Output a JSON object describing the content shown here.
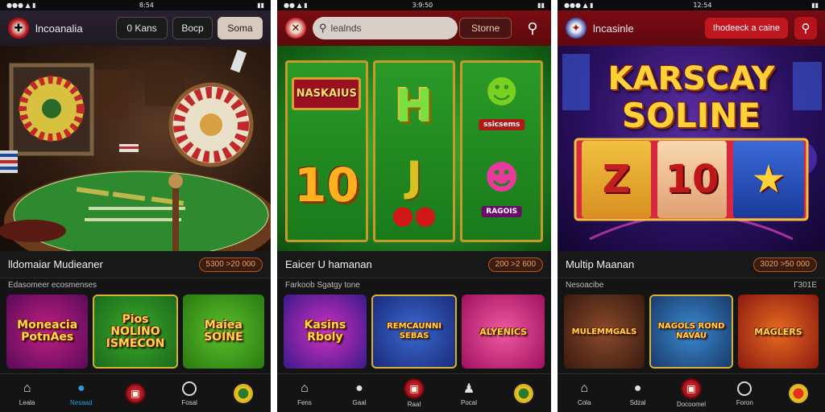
{
  "screens": [
    {
      "status": {
        "time": "8:54",
        "icons": "●●● ▲ ▮"
      },
      "header": {
        "app_name": "lncoanalia",
        "btn1": "0 Kans",
        "btn2": "Bocp",
        "btn3": "Soma"
      },
      "game_title": "lldomaiar Mudieaner",
      "badge": "5300 >20 000",
      "section_label": "Edasomeer ecosmenses",
      "thumbnails": [
        "Moneacia PotnAes",
        "Pios NOLINO ISMECON",
        "Maiea SOINE"
      ],
      "nav": [
        {
          "label": "Leala",
          "icon": "home-icon"
        },
        {
          "label": "Nesaad",
          "icon": "user-icon"
        },
        {
          "label": "",
          "icon": "wallet-icon"
        },
        {
          "label": "Fosal",
          "icon": "circle-icon"
        },
        {
          "label": "",
          "icon": "coin-icon"
        }
      ],
      "hero_labels": {
        "chips": "",
        "table_text": ""
      }
    },
    {
      "status": {
        "time": "3:9:50",
        "icons": "●● ▲ ▮"
      },
      "header": {
        "search_placeholder": "lealnds",
        "store_label": "Storne"
      },
      "hero": {
        "s1": "NASKAIUS",
        "s2": "H",
        "s3": "10",
        "s4": "J",
        "s5": "ssicsems",
        "s6": "RAGOIS"
      },
      "game_title": "Eaicer U hamanan",
      "badge": "200 >2 600",
      "section_label": "Farkoob Sgatgy tone",
      "thumbnails": [
        "Kasins Rboly",
        "REMCAUNNI SEBAS",
        "ALYENICS"
      ],
      "nav": [
        {
          "label": "Fens",
          "icon": "home-icon"
        },
        {
          "label": "Gaal",
          "icon": "user-icon"
        },
        {
          "label": "Raal",
          "icon": "wallet-icon"
        },
        {
          "label": "Pocal",
          "icon": "person-icon"
        },
        {
          "label": "",
          "icon": "coin-icon"
        }
      ]
    },
    {
      "status": {
        "time": "12:54",
        "icons": "●●● ▲ ▮"
      },
      "header": {
        "app_name": "lncasinle",
        "cta_label": "Ihodeeck a caine"
      },
      "hero": {
        "line1": "KARSCAY",
        "line2": "SOLINE",
        "r1": "Z",
        "r2": "10",
        "r3": "★"
      },
      "game_title": "Multip Maanan",
      "badge": "3020 >50 000",
      "section_label": "Nesoacibe",
      "section_right": "Г301E",
      "thumbnails": [
        "MULEMMGALS",
        "NAGOLS ROND NAVAU",
        "MAGLERS"
      ],
      "nav": [
        {
          "label": "Cola",
          "icon": "home-icon"
        },
        {
          "label": "Sdzal",
          "icon": "user-icon"
        },
        {
          "label": "Docoomel",
          "icon": "wallet-icon"
        },
        {
          "label": "Foron",
          "icon": "circle-icon"
        },
        {
          "label": "",
          "icon": "coin-icon"
        }
      ]
    }
  ],
  "colors": {
    "accent_red": "#c0161f",
    "accent_blue": "#2b9be0",
    "badge_orange": "#b5581f",
    "gold": "#ffd23a"
  }
}
